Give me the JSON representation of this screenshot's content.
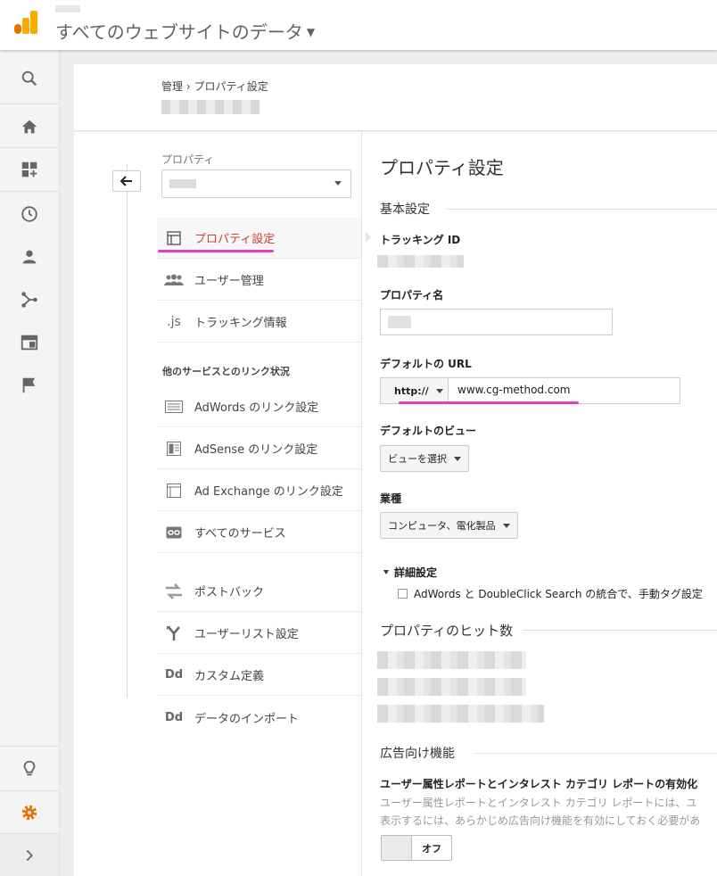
{
  "header": {
    "view_title": "すべてのウェブサイトのデータ"
  },
  "leftnav": {
    "icons": [
      "search-icon",
      "home-icon",
      "dashboard-add-icon",
      "clock-icon",
      "person-icon",
      "acquisition-icon",
      "behavior-icon",
      "flag-icon",
      "lightbulb-icon",
      "gear-icon",
      "chevron-right-icon"
    ],
    "accent_color": "#e37400"
  },
  "breadcrumb": {
    "root": "管理",
    "separator": "›",
    "current": "プロパティ設定"
  },
  "property_column": {
    "label": "プロパティ",
    "items": [
      {
        "label": "プロパティ設定",
        "icon": "property-icon"
      },
      {
        "label": "ユーザー管理",
        "icon": "users-icon"
      },
      {
        "label": "トラッキング情報",
        "icon": "js-icon"
      }
    ],
    "linking_section_label": "他のサービスとのリンク状況",
    "linking_items": [
      {
        "label": "AdWords のリンク設定",
        "icon": "adwords-icon"
      },
      {
        "label": "AdSense のリンク設定",
        "icon": "adsense-icon"
      },
      {
        "label": "Ad Exchange のリンク設定",
        "icon": "adexchange-icon"
      },
      {
        "label": "すべてのサービス",
        "icon": "link-icon"
      }
    ],
    "other_items": [
      {
        "label": "ポストバック",
        "icon": "postback-icon"
      },
      {
        "label": "ユーザーリスト設定",
        "icon": "fork-icon"
      },
      {
        "label": "カスタム定義",
        "icon": "dd-icon",
        "glyph": "Dd"
      },
      {
        "label": "データのインポート",
        "icon": "dd-icon",
        "glyph": "Dd"
      }
    ]
  },
  "settings": {
    "title": "プロパティ設定",
    "basic_section": "基本設定",
    "tracking_id_label": "トラッキング ID",
    "property_name_label": "プロパティ名",
    "default_url_label": "デフォルトの URL",
    "protocol": "http://",
    "url_value": "www.cg-method.com",
    "default_view_label": "デフォルトのビュー",
    "default_view_button": "ビューを選択",
    "industry_label": "業種",
    "industry_value": "コンピュータ、電化製品",
    "advanced_label": "詳細設定",
    "advanced_checkbox_label": "AdWords と DoubleClick Search の統合で、手動タグ設定",
    "hits_section": "プロパティのヒット数",
    "ads_section": "広告向け機能",
    "demographics_title": "ユーザー属性レポートとインタレスト カテゴリ レポートの有効化",
    "demographics_desc_1": "ユーザー属性レポートとインタレスト カテゴリ レポートには、ユ",
    "demographics_desc_2": "表示するには、あらかじめ広告向け機能を有効にしておく必要があ",
    "toggle_label": "オフ"
  },
  "highlight_color": "#e43ec6"
}
